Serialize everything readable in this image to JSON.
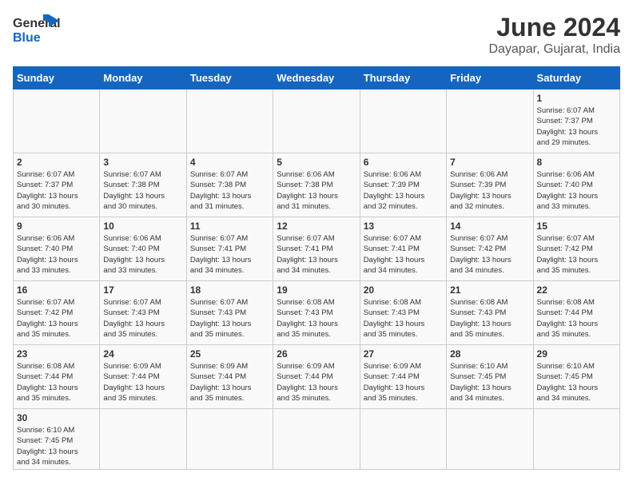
{
  "header": {
    "logo_general": "General",
    "logo_blue": "Blue",
    "month": "June 2024",
    "location": "Dayapar, Gujarat, India"
  },
  "weekdays": [
    "Sunday",
    "Monday",
    "Tuesday",
    "Wednesday",
    "Thursday",
    "Friday",
    "Saturday"
  ],
  "weeks": [
    [
      {
        "day": "",
        "info": ""
      },
      {
        "day": "",
        "info": ""
      },
      {
        "day": "",
        "info": ""
      },
      {
        "day": "",
        "info": ""
      },
      {
        "day": "",
        "info": ""
      },
      {
        "day": "",
        "info": ""
      },
      {
        "day": "1",
        "info": "Sunrise: 6:07 AM\nSunset: 7:37 PM\nDaylight: 13 hours\nand 29 minutes."
      }
    ],
    [
      {
        "day": "2",
        "info": "Sunrise: 6:07 AM\nSunset: 7:37 PM\nDaylight: 13 hours\nand 30 minutes."
      },
      {
        "day": "3",
        "info": "Sunrise: 6:07 AM\nSunset: 7:38 PM\nDaylight: 13 hours\nand 30 minutes."
      },
      {
        "day": "4",
        "info": "Sunrise: 6:07 AM\nSunset: 7:38 PM\nDaylight: 13 hours\nand 31 minutes."
      },
      {
        "day": "5",
        "info": "Sunrise: 6:06 AM\nSunset: 7:38 PM\nDaylight: 13 hours\nand 31 minutes."
      },
      {
        "day": "6",
        "info": "Sunrise: 6:06 AM\nSunset: 7:39 PM\nDaylight: 13 hours\nand 32 minutes."
      },
      {
        "day": "7",
        "info": "Sunrise: 6:06 AM\nSunset: 7:39 PM\nDaylight: 13 hours\nand 32 minutes."
      },
      {
        "day": "8",
        "info": "Sunrise: 6:06 AM\nSunset: 7:40 PM\nDaylight: 13 hours\nand 33 minutes."
      }
    ],
    [
      {
        "day": "9",
        "info": "Sunrise: 6:06 AM\nSunset: 7:40 PM\nDaylight: 13 hours\nand 33 minutes."
      },
      {
        "day": "10",
        "info": "Sunrise: 6:06 AM\nSunset: 7:40 PM\nDaylight: 13 hours\nand 33 minutes."
      },
      {
        "day": "11",
        "info": "Sunrise: 6:07 AM\nSunset: 7:41 PM\nDaylight: 13 hours\nand 34 minutes."
      },
      {
        "day": "12",
        "info": "Sunrise: 6:07 AM\nSunset: 7:41 PM\nDaylight: 13 hours\nand 34 minutes."
      },
      {
        "day": "13",
        "info": "Sunrise: 6:07 AM\nSunset: 7:41 PM\nDaylight: 13 hours\nand 34 minutes."
      },
      {
        "day": "14",
        "info": "Sunrise: 6:07 AM\nSunset: 7:42 PM\nDaylight: 13 hours\nand 34 minutes."
      },
      {
        "day": "15",
        "info": "Sunrise: 6:07 AM\nSunset: 7:42 PM\nDaylight: 13 hours\nand 35 minutes."
      }
    ],
    [
      {
        "day": "16",
        "info": "Sunrise: 6:07 AM\nSunset: 7:42 PM\nDaylight: 13 hours\nand 35 minutes."
      },
      {
        "day": "17",
        "info": "Sunrise: 6:07 AM\nSunset: 7:43 PM\nDaylight: 13 hours\nand 35 minutes."
      },
      {
        "day": "18",
        "info": "Sunrise: 6:07 AM\nSunset: 7:43 PM\nDaylight: 13 hours\nand 35 minutes."
      },
      {
        "day": "19",
        "info": "Sunrise: 6:08 AM\nSunset: 7:43 PM\nDaylight: 13 hours\nand 35 minutes."
      },
      {
        "day": "20",
        "info": "Sunrise: 6:08 AM\nSunset: 7:43 PM\nDaylight: 13 hours\nand 35 minutes."
      },
      {
        "day": "21",
        "info": "Sunrise: 6:08 AM\nSunset: 7:43 PM\nDaylight: 13 hours\nand 35 minutes."
      },
      {
        "day": "22",
        "info": "Sunrise: 6:08 AM\nSunset: 7:44 PM\nDaylight: 13 hours\nand 35 minutes."
      }
    ],
    [
      {
        "day": "23",
        "info": "Sunrise: 6:08 AM\nSunset: 7:44 PM\nDaylight: 13 hours\nand 35 minutes."
      },
      {
        "day": "24",
        "info": "Sunrise: 6:09 AM\nSunset: 7:44 PM\nDaylight: 13 hours\nand 35 minutes."
      },
      {
        "day": "25",
        "info": "Sunrise: 6:09 AM\nSunset: 7:44 PM\nDaylight: 13 hours\nand 35 minutes."
      },
      {
        "day": "26",
        "info": "Sunrise: 6:09 AM\nSunset: 7:44 PM\nDaylight: 13 hours\nand 35 minutes."
      },
      {
        "day": "27",
        "info": "Sunrise: 6:09 AM\nSunset: 7:44 PM\nDaylight: 13 hours\nand 35 minutes."
      },
      {
        "day": "28",
        "info": "Sunrise: 6:10 AM\nSunset: 7:45 PM\nDaylight: 13 hours\nand 34 minutes."
      },
      {
        "day": "29",
        "info": "Sunrise: 6:10 AM\nSunset: 7:45 PM\nDaylight: 13 hours\nand 34 minutes."
      }
    ],
    [
      {
        "day": "30",
        "info": "Sunrise: 6:10 AM\nSunset: 7:45 PM\nDaylight: 13 hours\nand 34 minutes."
      },
      {
        "day": "",
        "info": ""
      },
      {
        "day": "",
        "info": ""
      },
      {
        "day": "",
        "info": ""
      },
      {
        "day": "",
        "info": ""
      },
      {
        "day": "",
        "info": ""
      },
      {
        "day": "",
        "info": ""
      }
    ]
  ]
}
